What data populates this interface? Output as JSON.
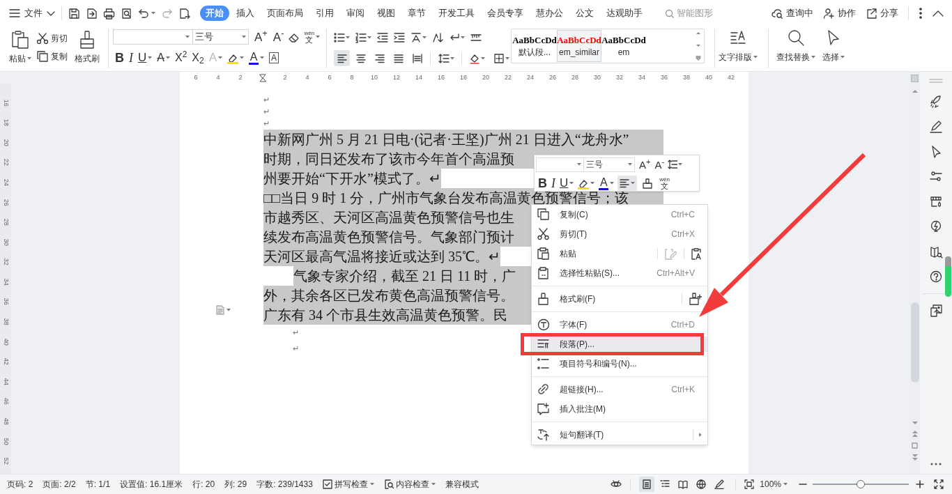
{
  "app_menu": {
    "label": "文件"
  },
  "tabs": [
    {
      "label": "开始",
      "selected": true
    },
    {
      "label": "插入",
      "selected": false
    },
    {
      "label": "页面布局",
      "selected": false
    },
    {
      "label": "引用",
      "selected": false
    },
    {
      "label": "审阅",
      "selected": false
    },
    {
      "label": "视图",
      "selected": false
    },
    {
      "label": "章节",
      "selected": false
    },
    {
      "label": "开发工具",
      "selected": false
    },
    {
      "label": "会员专享",
      "selected": false
    },
    {
      "label": "慧办公",
      "selected": false
    },
    {
      "label": "公文",
      "selected": false
    },
    {
      "label": "达观助手",
      "selected": false
    }
  ],
  "smart_search": {
    "placeholder": "智能图形"
  },
  "header_actions": [
    "查询中",
    "协作",
    "分享"
  ],
  "ribbon": {
    "paste": "粘贴",
    "cut": "剪切",
    "copy": "复制",
    "format_painter": "格式刷",
    "font_size": "三号",
    "size_buttons": [
      {
        "label": "A$^{+}$"
      },
      {
        "label": "A$^{-}$"
      }
    ],
    "phonetic": {
      "top": "wén",
      "bottom": "文"
    },
    "font_buttons": [
      {
        "kind": "bold",
        "label": "B"
      },
      {
        "kind": "italic",
        "label": "I"
      },
      {
        "kind": "underline",
        "label": "U"
      },
      {
        "kind": "strike",
        "label": "A"
      },
      {
        "kind": "superscript",
        "label": "X$^{2}$"
      },
      {
        "kind": "subscript",
        "label": "X$_{2}$"
      },
      {
        "kind": "effect",
        "label": "A"
      },
      {
        "kind": "highlight",
        "color": "#f2e600"
      },
      {
        "kind": "color",
        "label": "A",
        "color": "#1010e0"
      },
      {
        "kind": "border",
        "label": "A"
      }
    ],
    "alignment": [
      {
        "selected": true
      },
      {
        "selected": false
      },
      {
        "selected": false
      },
      {
        "selected": false
      },
      {
        "selected": false
      }
    ],
    "styles": [
      {
        "sample": "AaBbCcDd",
        "name": "默认段...",
        "selected": false,
        "color": "#000000"
      },
      {
        "sample": "AaBbCcDd",
        "name": "em_similar",
        "selected": true,
        "color": "#ff0000"
      },
      {
        "sample": "AaBbCcDd",
        "name": "em",
        "selected": false,
        "color": "#000000"
      }
    ],
    "text_layout": "文字排版",
    "find_replace": "查找替换",
    "select": "选择"
  },
  "ruler": {
    "h_ticks": [
      "6",
      "4",
      "2",
      "2",
      "4",
      "6",
      "8",
      "10",
      "12",
      "14",
      "16",
      "18",
      "20",
      "22",
      "24",
      "26",
      "28",
      "30",
      "32",
      "34",
      "36",
      "38",
      "40",
      "42"
    ],
    "v_ticks": [
      "16",
      "18",
      "20",
      "22",
      "24",
      "26",
      "28",
      "30",
      "32",
      "34",
      "36",
      "38",
      "40",
      "42",
      "44",
      "46",
      "48",
      "50",
      "52"
    ]
  },
  "document": {
    "lines": [
      {
        "kind": "blank",
        "text": "↵",
        "selected": false
      },
      {
        "kind": "blank",
        "text": "↵",
        "selected": false
      },
      {
        "kind": "blank",
        "text": "↵",
        "selected": false
      },
      {
        "kind": "wrap",
        "text": "中新网广州 5 月 21 日电·(记者·王坚)广州 21 日进入“龙舟水”",
        "selected": true
      },
      {
        "kind": "wrap",
        "text": "时期，同日还发布了该市今年首个高温预",
        "selected": true
      },
      {
        "kind": "end",
        "text": "州要开始“下开水”模式了。↵",
        "selected": true
      },
      {
        "kind": "wrap",
        "text": "□□当日 9 时 1 分，广州市气象台发布高温黄色预警信号；该",
        "selected": true
      },
      {
        "kind": "wrap",
        "text": "市越秀区、天河区高温黄色预警信号也生",
        "selected": true
      },
      {
        "kind": "wrap",
        "text": "续发布高温黄色预警信号。气象部门预计",
        "selected": true
      },
      {
        "kind": "end",
        "text": "天河区最高气温将接近或达到 35℃。↵",
        "selected": true
      },
      {
        "kind": "indent_wrap",
        "text": "气象专家介绍，截至 21 日 11 时，广",
        "selected": true
      },
      {
        "kind": "wrap",
        "text": "外，其余各区已发布黄色高温预警信号。",
        "selected": true
      },
      {
        "kind": "wrap",
        "text": "广东有 34 个市县生效高温黄色预警。民",
        "selected": true
      },
      {
        "kind": "blank_indent",
        "text": "↵",
        "selected": false
      },
      {
        "kind": "blank_indent",
        "text": "↵",
        "selected": false
      }
    ]
  },
  "mini_toolbar": {
    "font_size": "三号",
    "size_buttons": [
      {
        "label": "A$^{+}$"
      },
      {
        "label": "A$^{-}$"
      }
    ],
    "buttons": [
      {
        "kind": "bold",
        "label": "B"
      },
      {
        "kind": "italic",
        "label": "I"
      },
      {
        "kind": "underline",
        "label": "U"
      },
      {
        "kind": "highlight",
        "color": "#f2e600"
      },
      {
        "kind": "color",
        "label": "A",
        "color": "#1010e0"
      }
    ],
    "phonetic": {
      "top": "wén",
      "bottom": "文"
    }
  },
  "context_menu": {
    "groups": [
      [
        {
          "label": "复制(C)",
          "shortcut": "Ctrl+C",
          "kind": "plain",
          "selected": false
        },
        {
          "label": "剪切(T)",
          "shortcut": "Ctrl+X",
          "kind": "plain",
          "selected": false
        },
        {
          "label": "粘贴",
          "kind": "paste",
          "selected": false
        },
        {
          "label": "选择性粘贴(S)...",
          "shortcut": "Ctrl+Alt+V",
          "kind": "plain",
          "selected": false
        }
      ],
      [
        {
          "label": "格式刷(F)",
          "kind": "painter",
          "selected": false
        }
      ],
      [
        {
          "label": "字体(F)",
          "shortcut": "Ctrl+D",
          "kind": "plain",
          "selected": false
        },
        {
          "label": "段落(P)...",
          "kind": "plain",
          "selected": true
        },
        {
          "label": "项目符号和编号(N)...",
          "kind": "plain",
          "selected": false
        }
      ],
      [
        {
          "label": "超链接(H)...",
          "shortcut": "Ctrl+K",
          "kind": "plain",
          "selected": false
        },
        {
          "label": "插入批注(M)",
          "kind": "plain",
          "selected": false
        }
      ],
      [
        {
          "label": "短句翻译(T)",
          "kind": "submenu",
          "selected": false
        }
      ]
    ]
  },
  "status_bar": {
    "items": [
      {
        "text": "页码: 2",
        "kind": "text"
      },
      {
        "text": "页面: 2/2",
        "kind": "text"
      },
      {
        "text": "节: 1/1",
        "kind": "text"
      },
      {
        "text": "设置值: 16.1厘米",
        "kind": "text"
      },
      {
        "text": "行: 20",
        "kind": "text"
      },
      {
        "text": "列: 29",
        "kind": "text"
      },
      {
        "text": "字数: 239/1433",
        "kind": "text"
      },
      {
        "text": "拼写检查",
        "kind": "dropdown"
      },
      {
        "text": "内容检查",
        "kind": "dropdown"
      },
      {
        "text": "兼容模式",
        "kind": "text"
      }
    ],
    "view_modes": [
      {
        "selected": true
      },
      {
        "selected": false
      },
      {
        "selected": false
      },
      {
        "selected": false
      },
      {
        "selected": false
      }
    ],
    "zoom": "100%",
    "zoom_slider": {
      "level": 0.5
    }
  }
}
